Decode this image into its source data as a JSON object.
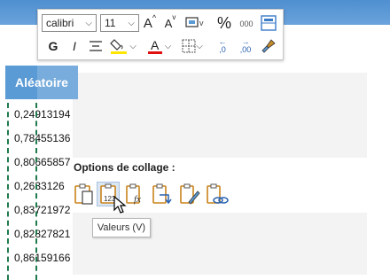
{
  "sheet": {
    "column_header": "Aléatoire",
    "cells": [
      "0,24913194",
      "0,78455136",
      "0,80665857",
      "0,2633126",
      "0,83721972",
      "0,82827821",
      "0,86159166"
    ]
  },
  "minibar": {
    "font_name": "calibri",
    "font_size": "11",
    "bold": "G",
    "italic": "I",
    "percent": "%",
    "thousands": "000",
    "increase_font": "A",
    "decrease_font": "A",
    "font_color": "A",
    "decimal_increase": ",0",
    "decimal_decrease": ",00"
  },
  "paste_options": {
    "title": "Options de collage :",
    "tooltip": "Valeurs (V)"
  },
  "colors": {
    "header_blue": "#5a9ad5",
    "highlight_yellow": "#ffe600",
    "font_red": "#e01010",
    "marquee_green": "#1f7a4d"
  }
}
